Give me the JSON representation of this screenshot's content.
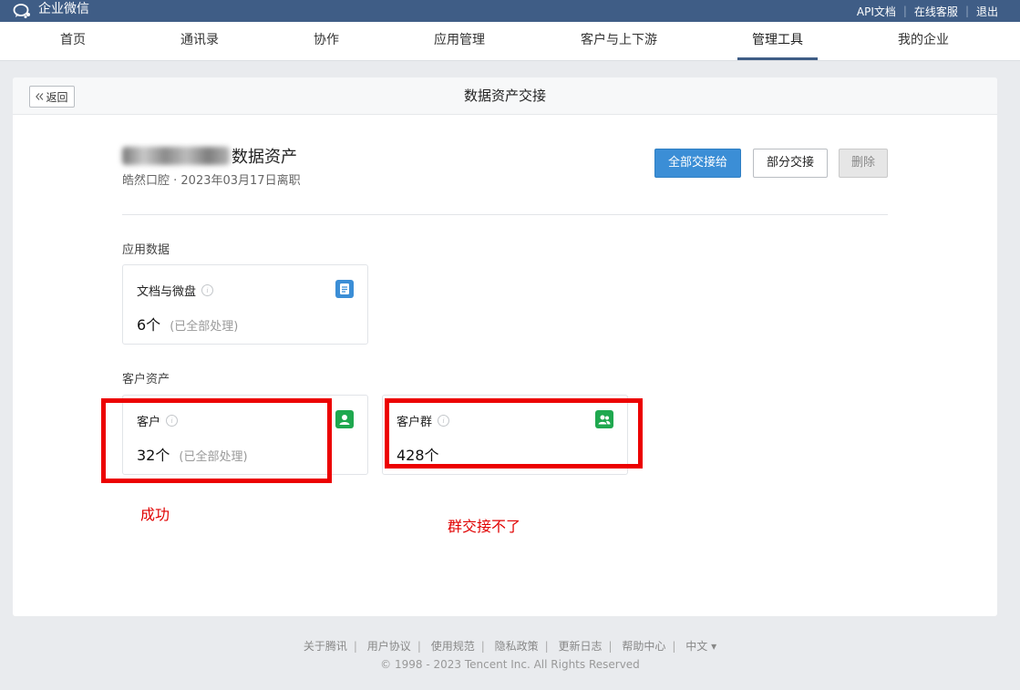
{
  "app": {
    "logo_text": "企业微信",
    "top_links": [
      "API文档",
      "在线客服",
      "退出"
    ]
  },
  "nav": {
    "items": [
      "首页",
      "通讯录",
      "协作",
      "应用管理",
      "客户与上下游",
      "管理工具",
      "我的企业"
    ],
    "active": "管理工具"
  },
  "header": {
    "back_label": "返回",
    "title": "数据资产交接"
  },
  "person": {
    "name_suffix": "数据资产",
    "subtitle": "皓然口腔 · 2023年03月17日离职"
  },
  "actions": {
    "transfer_all": "全部交接给",
    "transfer_partial": "部分交接",
    "delete": "删除"
  },
  "sections": {
    "app_data_label": "应用数据",
    "customer_assets_label": "客户资产"
  },
  "tiles": {
    "docs": {
      "title": "文档与微盘",
      "count": "6个",
      "note": "(已全部处理)",
      "icon": "doc-icon",
      "color": "#3b8ed6"
    },
    "customers": {
      "title": "客户",
      "count": "32个",
      "note": "(已全部处理)",
      "icon": "person-icon",
      "color": "#1fa84f"
    },
    "groups": {
      "title": "客户群",
      "count": "428个",
      "icon": "group-icon",
      "color": "#1fa84f"
    }
  },
  "annotations": {
    "success": "成功",
    "group_fail": "群交接不了",
    "color": "#ec0000"
  },
  "footer": {
    "links": [
      "关于腾讯",
      "用户协议",
      "使用规范",
      "隐私政策",
      "更新日志",
      "帮助中心"
    ],
    "language": "中文 ▾",
    "copyright": "© 1998 - 2023 Tencent Inc. All Rights Reserved"
  }
}
